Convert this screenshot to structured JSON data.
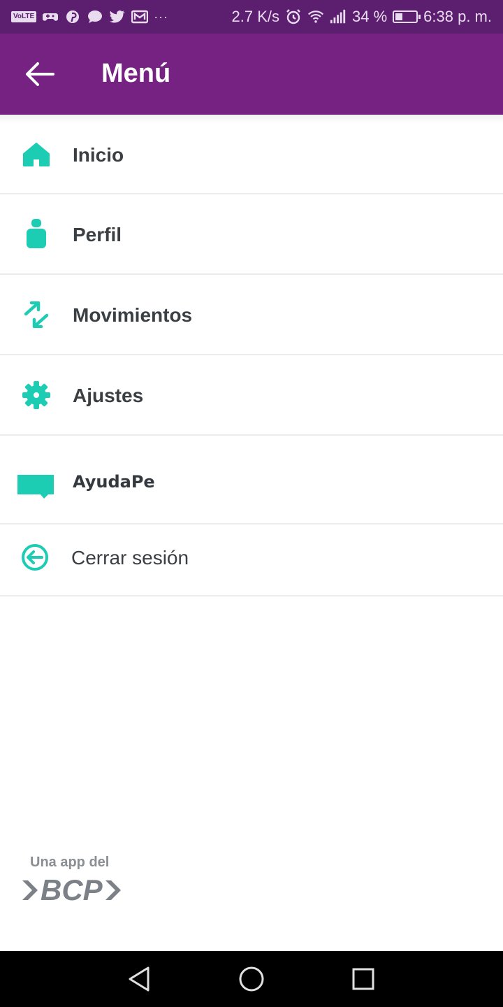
{
  "status_bar": {
    "badge": "VoLTE",
    "speed": "2.7 K/s",
    "battery": "34 %",
    "battery_level": 0.34,
    "time": "6:38 p. m.",
    "notification_icons": [
      "game-controller-icon",
      "pinterest-icon",
      "chat-bubble-icon",
      "twitter-icon",
      "gmail-icon"
    ],
    "overflow": "···"
  },
  "app_bar": {
    "title": "Menú",
    "background": "#752283"
  },
  "menu": {
    "accent": "#1cccb3",
    "items": [
      {
        "label": "Inicio",
        "icon": "home-icon"
      },
      {
        "label": "Perfil",
        "icon": "person-icon"
      },
      {
        "label": "Movimientos",
        "icon": "transfer-arrows-icon"
      },
      {
        "label": "Ajustes",
        "icon": "gear-icon"
      },
      {
        "label": "AyudaPe",
        "icon": "chat-flag-icon"
      },
      {
        "label": "Cerrar sesión",
        "icon": "logout-icon"
      }
    ]
  },
  "footer": {
    "caption": "Una app del",
    "brand": "BCP"
  }
}
